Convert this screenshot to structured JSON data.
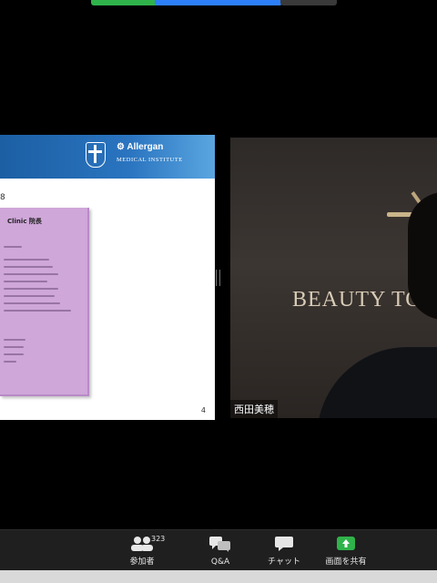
{
  "meeting": {
    "participant_count": "323"
  },
  "slide": {
    "brand_name": "Allergan",
    "brand_subtitle": "MEDICAL INSTITUTE",
    "marker": "8",
    "card_title": "Clinic 院長",
    "page_number": "4",
    "colors": {
      "header": "#2a74c0",
      "card": "#cfa7d9"
    }
  },
  "video": {
    "wall_text": "BEAUTY TO",
    "speaker_name": "西田美穂"
  },
  "toolbar": {
    "participants_label": "参加者",
    "qa_label": "Q&A",
    "chat_label": "チャット",
    "share_label": "画面を共有",
    "icons": [
      "participants-icon",
      "qa-icon",
      "chat-icon",
      "share-screen-icon"
    ],
    "share_color": "#2fb34a"
  }
}
